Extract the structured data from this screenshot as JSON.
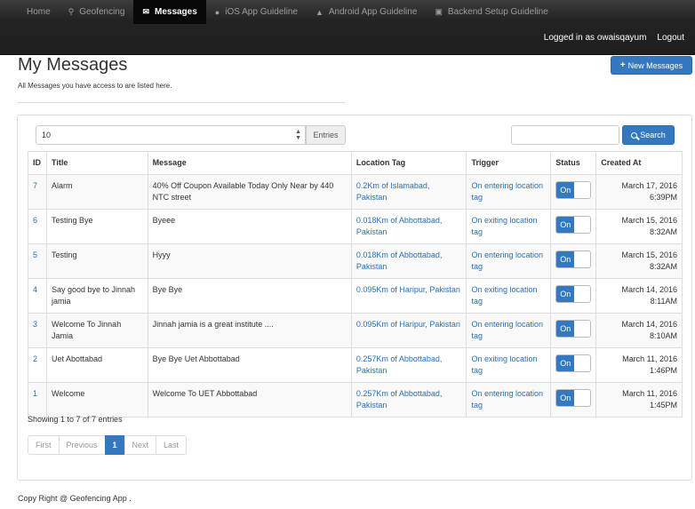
{
  "nav": {
    "items": [
      {
        "label": "Home",
        "icon": ""
      },
      {
        "label": "Geofencing",
        "icon": "map-marker-icon"
      },
      {
        "label": "Messages",
        "icon": "envelope-icon",
        "active": true
      },
      {
        "label": "iOS App Guideline",
        "icon": "apple-icon"
      },
      {
        "label": "Android App Guideline",
        "icon": "android-icon"
      },
      {
        "label": "Backend Setup Guideline",
        "icon": "monitor-icon"
      }
    ],
    "logged_in": "Logged in as owaisqayum",
    "logout": "Logout"
  },
  "header": {
    "title": "My Messages",
    "subtitle": "All Messages you have access to are listed here.",
    "new_button": "New Messages"
  },
  "controls": {
    "entries_value": "10",
    "entries_label": "Entries",
    "search_placeholder": "",
    "search_button": "Search"
  },
  "table": {
    "headers": [
      "ID",
      "Title",
      "Message",
      "Location Tag",
      "Trigger",
      "Status",
      "Created At"
    ],
    "rows": [
      {
        "id": "7",
        "title": "Alarm",
        "message": "40% Off Coupon Available Today Only Near by 440 NTC street",
        "location": "0.2Km of Islamabad, Pakistan",
        "trigger": "On entering location tag",
        "status": "On",
        "date": "March 17, 2016",
        "time": "6:39PM"
      },
      {
        "id": "6",
        "title": "Testing Bye",
        "message": "Byeee",
        "location": "0.018Km of Abbottabad, Pakistan",
        "trigger": "On exiting location tag",
        "status": "On",
        "date": "March 15, 2016",
        "time": "8:32AM"
      },
      {
        "id": "5",
        "title": "Testing",
        "message": "Hyyy",
        "location": "0.018Km of Abbottabad, Pakistan",
        "trigger": "On entering location tag",
        "status": "On",
        "date": "March 15, 2016",
        "time": "8:32AM"
      },
      {
        "id": "4",
        "title": "Say good bye to Jinnah jamia",
        "message": "Bye Bye",
        "location": "0.095Km of Haripur, Pakistan",
        "trigger": "On exiting location tag",
        "status": "On",
        "date": "March 14, 2016",
        "time": "8:11AM"
      },
      {
        "id": "3",
        "title": "Welcome To Jinnah Jamia",
        "message": "Jinnah jamia is a great institute ....",
        "location": "0.095Km of Haripur, Pakistan",
        "trigger": "On entering location tag",
        "status": "On",
        "date": "March 14, 2016",
        "time": "8:10AM"
      },
      {
        "id": "2",
        "title": "Uet Abottabad",
        "message": "Bye Bye Uet Abbottabad",
        "location": "0.257Km of Abbottabad, Pakistan",
        "trigger": "On exiting location tag",
        "status": "On",
        "date": "March 11, 2016",
        "time": "1:46PM"
      },
      {
        "id": "1",
        "title": "Welcome",
        "message": "Welcome To UET Abbottabad",
        "location": "0.257Km of Abbottabad, Pakistan",
        "trigger": "On entering location tag",
        "status": "On",
        "date": "March 11, 2016",
        "time": "1:45PM"
      }
    ]
  },
  "showing": "Showing 1 to 7 of 7 entries",
  "pagination": [
    "First",
    "Previous",
    "1",
    "Next",
    "Last"
  ],
  "footer": "Copy Right @ Geofencing App .",
  "colors": {
    "primary": "#3478c0",
    "link": "#2a6fb4",
    "navbar": "#222222"
  }
}
